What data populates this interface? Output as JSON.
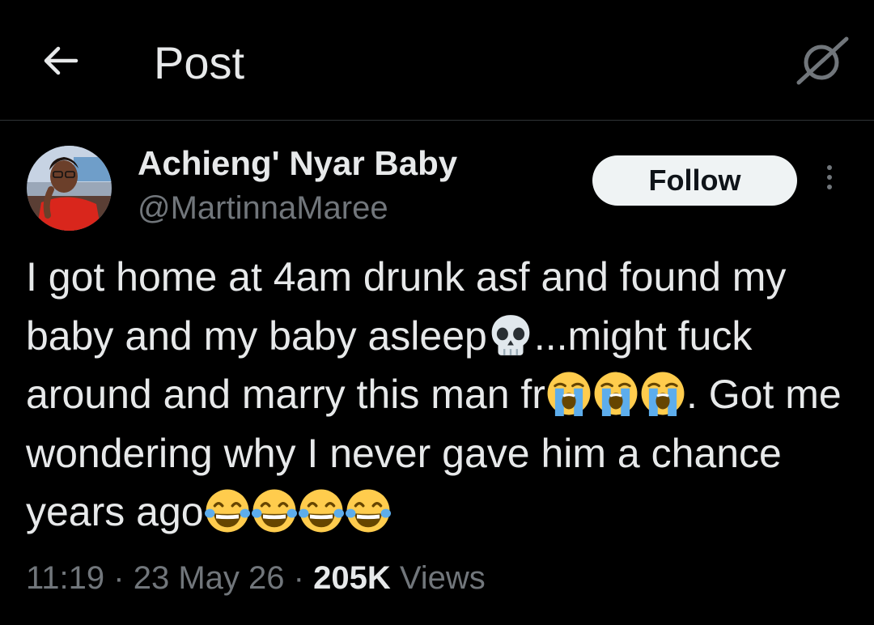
{
  "header": {
    "title": "Post",
    "back_icon": "arrow-left-icon",
    "grok_icon": "grok-icon"
  },
  "author": {
    "display_name": "Achieng' Nyar Baby",
    "handle": "@MartinnaMaree",
    "follow_label": "Follow",
    "more_icon": "more-vertical-icon"
  },
  "tweet": {
    "segments": [
      {
        "type": "text",
        "value": "I got home at 4am drunk asf and found my baby and my baby asleep"
      },
      {
        "type": "emoji",
        "value": "skull"
      },
      {
        "type": "text",
        "value": "...might fuck around and marry this man fr"
      },
      {
        "type": "emoji",
        "value": "loudly-crying"
      },
      {
        "type": "emoji",
        "value": "loudly-crying"
      },
      {
        "type": "emoji",
        "value": "loudly-crying"
      },
      {
        "type": "text",
        "value": ". Got me wondering why I never gave him a chance years ago"
      },
      {
        "type": "emoji",
        "value": "tears-of-joy"
      },
      {
        "type": "emoji",
        "value": "tears-of-joy"
      },
      {
        "type": "emoji",
        "value": "tears-of-joy"
      },
      {
        "type": "emoji",
        "value": "tears-of-joy"
      }
    ]
  },
  "meta": {
    "time": "11:19",
    "separator": "·",
    "date": "23 May 26",
    "views_count": "205K",
    "views_label": "Views"
  },
  "colors": {
    "background": "#000000",
    "text_primary": "#e7e9ea",
    "text_secondary": "#71767b",
    "divider": "#2f3336",
    "follow_bg": "#eff3f4",
    "follow_text": "#0f1419"
  }
}
